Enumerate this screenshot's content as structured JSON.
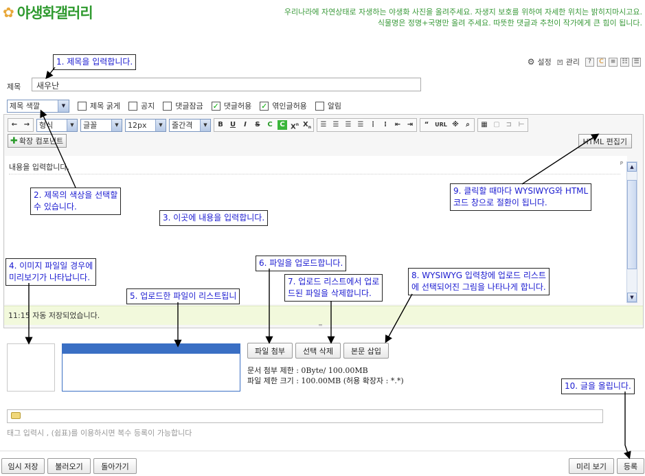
{
  "header": {
    "title": "야생화갤러리",
    "notice_line1": "우리나라에 자연상태로 자생하는 야생화 사진을 올려주세요. 자생지 보호를 위하여 자세한 위치는 밝히지마시고요.",
    "notice_line2": "식물명은 정명+국명만 올려 주세요. 따뜻한 댓글과 추천이 작가에게 큰 힘이 됩니다."
  },
  "top_tools": {
    "settings": "설정",
    "manage": "관리"
  },
  "form": {
    "title_label": "제목",
    "title_value": "새우난",
    "title_color": "제목 색깔",
    "options": [
      {
        "label": "제목 굵게",
        "checked": false
      },
      {
        "label": "공지",
        "checked": false
      },
      {
        "label": "댓글잠금",
        "checked": false
      },
      {
        "label": "댓글허용",
        "checked": true
      },
      {
        "label": "엮인글허용",
        "checked": true
      },
      {
        "label": "알림",
        "checked": false
      }
    ]
  },
  "editor": {
    "selects": {
      "style": "형식",
      "font": "글꼴",
      "size": "12px",
      "line": "줄간격"
    },
    "format_buttons": [
      "B",
      "U",
      "I",
      "S",
      "C",
      "C",
      "X",
      "X"
    ],
    "insert_buttons": [
      "“",
      "URL",
      "※",
      "🔍"
    ],
    "extend_component": "확장 컴포넌트",
    "html_editor": "HTML 편집기",
    "placeholder": "내용을 입력합니다.",
    "p_marker": "P",
    "autosave": "11:15 자동 저장되었습니다."
  },
  "upload": {
    "attach": "파일 첨부",
    "delete": "선택 삭제",
    "insert": "본문 삽입",
    "limit_line1": "문서 첨부 제한 : 0Byte/ 100.00MB",
    "limit_line2": "파일 제한 크기 : 100.00MB (허용 확장자 : *.*)"
  },
  "tag": {
    "hint": "태그 입력시 , (쉼표)를 이용하시면 복수 등록이 가능합니다"
  },
  "footer": {
    "temp_save": "임시 저장",
    "load": "불러오기",
    "back": "돌아가기",
    "preview": "미리 보기",
    "submit": "등록"
  },
  "annotations": {
    "a1": "1. 제목을 입력합니다.",
    "a2_line1": "2. 제목의 색상을 선택할",
    "a2_line2": "수 있습니다.",
    "a3": "3. 이곳에 내용을 입력합니다.",
    "a4_line1": "4. 이미지 파일일 경우에",
    "a4_line2": "미리보기가 나타납니다.",
    "a5": "5. 업로드한 파일이 리스트됩니",
    "a6": "6. 파일을 업로드합니다.",
    "a7_line1": "7. 업로드 리스트에서 업로",
    "a7_line2": "드된 파일을 삭제합니다.",
    "a8_line1": "8. WYSIWYG 입력창에 업로드 리스트",
    "a8_line2": "에 선택되어진 그림을 나타나게 합니다.",
    "a9_line1": "9. 클릭할 때마다 WYSIWYG와 HTML",
    "a9_line2": "코드 창으로 절환이 됩니다.",
    "a10": "10. 글을 올립니다."
  },
  "colors": {
    "brand_green": "#2f9a2f",
    "annotation_blue": "#1a1ad0",
    "list_selection": "#3a6fc4",
    "autosave_bg": "#f2f9dc"
  }
}
